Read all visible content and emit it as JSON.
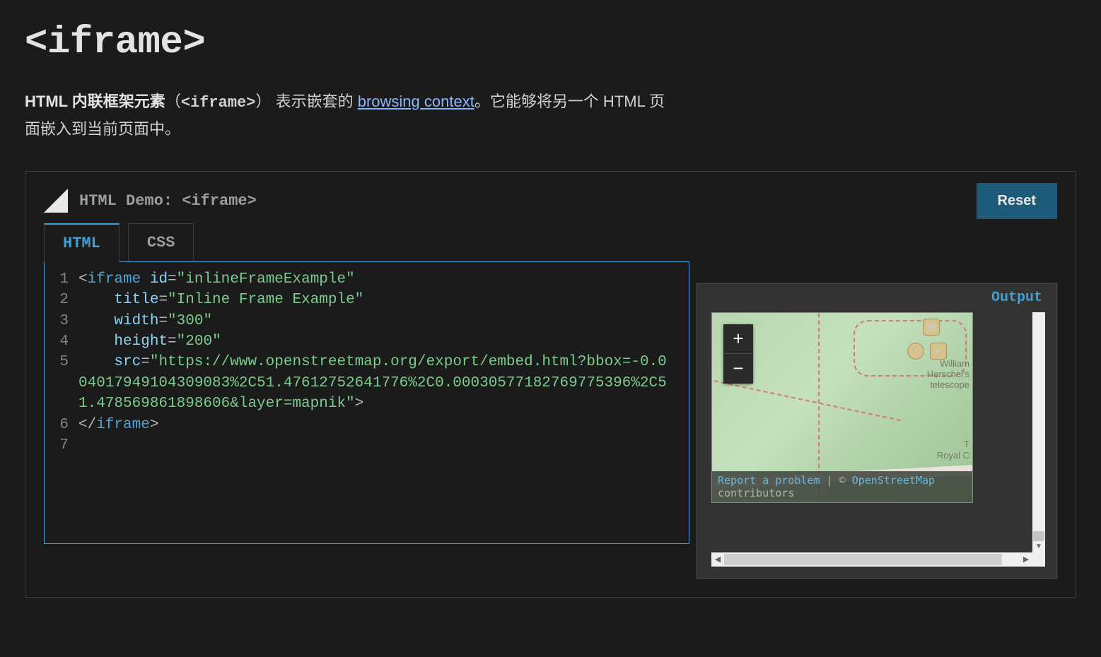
{
  "page": {
    "title": "<iframe>",
    "intro_bold": "HTML 内联框架元素",
    "intro_paren_open": "（",
    "intro_code": "<iframe>",
    "intro_paren_close": "）",
    "intro_part1": "表示嵌套的 ",
    "intro_link": "browsing context",
    "intro_part2": "。它能够将另一个 HTML 页面嵌入到当前页面中。"
  },
  "demo": {
    "header_label": "HTML Demo: <iframe>",
    "reset_label": "Reset",
    "tabs": {
      "html": "HTML",
      "css": "CSS"
    },
    "output_label": "Output"
  },
  "code": {
    "line_numbers": [
      "1",
      "2",
      "3",
      "4",
      "5",
      "6",
      "7"
    ],
    "l1": {
      "open": "<",
      "tag": "iframe",
      "sp": " ",
      "attr": "id",
      "eq": "=",
      "val": "\"inlineFrameExample\""
    },
    "l2": {
      "indent": "    ",
      "attr": "title",
      "eq": "=",
      "val": "\"Inline Frame Example\""
    },
    "l3": {
      "indent": "    ",
      "attr": "width",
      "eq": "=",
      "val": "\"300\""
    },
    "l4": {
      "indent": "    ",
      "attr": "height",
      "eq": "=",
      "val": "\"200\""
    },
    "l5": {
      "indent": "    ",
      "attr": "src",
      "eq": "=",
      "val_a": "\"https://www.openstreetmap.org/export/embed.html?",
      "val_b": "bbox=-0.004017949104309083%2C51.47612752641776%2C0.00030577182769775396%2C51.478569861898606&layer=mapnik\"",
      "close": ">"
    },
    "l6": {
      "open": "</",
      "tag": "iframe",
      "close": ">"
    }
  },
  "output": {
    "zoom_in": "+",
    "zoom_out": "−",
    "poi_label_1": "William Herschel's telescope",
    "poi_label_2": "Royal C",
    "poi_label_3": "T",
    "footer_report": "Report a problem",
    "footer_sep": " | © ",
    "footer_osm": "OpenStreetMap",
    "footer_contrib": "contributors"
  }
}
